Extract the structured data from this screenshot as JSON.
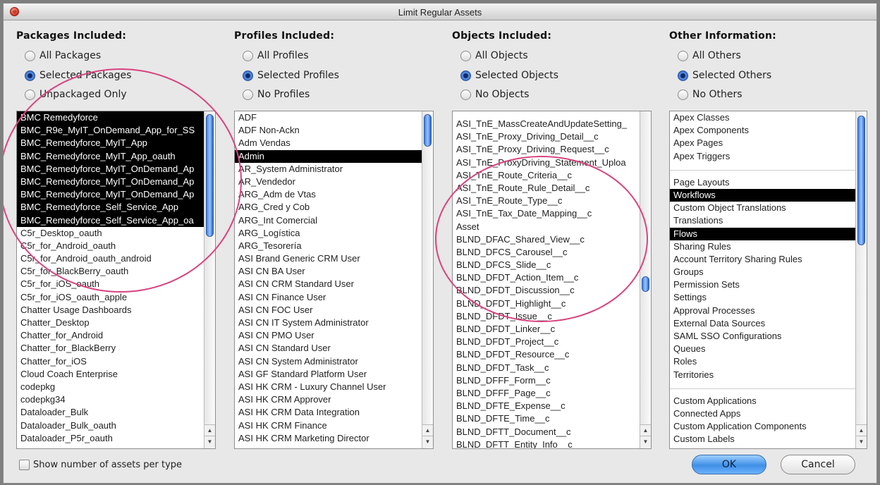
{
  "window": {
    "title": "Limit Regular Assets"
  },
  "columns": [
    {
      "header": "Packages Included:",
      "radios": [
        {
          "label": "All Packages",
          "checked": false
        },
        {
          "label": "Selected Packages",
          "checked": true
        },
        {
          "label": "Unpackaged Only",
          "checked": false
        }
      ],
      "items": [
        {
          "label": "BMC Remedyforce",
          "selected": true
        },
        {
          "label": "BMC_R9e_MyIT_OnDemand_App_for_SS",
          "selected": true
        },
        {
          "label": "BMC_Remedyforce_MyIT_App",
          "selected": true
        },
        {
          "label": "BMC_Remedyforce_MyIT_App_oauth",
          "selected": true
        },
        {
          "label": "BMC_Remedyforce_MyIT_OnDemand_Ap",
          "selected": true
        },
        {
          "label": "BMC_Remedyforce_MyIT_OnDemand_Ap",
          "selected": true
        },
        {
          "label": "BMC_Remedyforce_MyIT_OnDemand_Ap",
          "selected": true
        },
        {
          "label": "BMC_Remedyforce_Self_Service_App",
          "selected": true
        },
        {
          "label": "BMC_Remedyforce_Self_Service_App_oa",
          "selected": true
        },
        {
          "label": "C5r_Desktop_oauth",
          "selected": false
        },
        {
          "label": "C5r_for_Android_oauth",
          "selected": false
        },
        {
          "label": "C5r_for_Android_oauth_android",
          "selected": false
        },
        {
          "label": "C5r_for_BlackBerry_oauth",
          "selected": false
        },
        {
          "label": "C5r_for_iOS_oauth",
          "selected": false
        },
        {
          "label": "C5r_for_iOS_oauth_apple",
          "selected": false
        },
        {
          "label": "Chatter Usage Dashboards",
          "selected": false
        },
        {
          "label": "Chatter_Desktop",
          "selected": false
        },
        {
          "label": "Chatter_for_Android",
          "selected": false
        },
        {
          "label": "Chatter_for_BlackBerry",
          "selected": false
        },
        {
          "label": "Chatter_for_iOS",
          "selected": false
        },
        {
          "label": "Cloud Coach Enterprise",
          "selected": false
        },
        {
          "label": "codepkg",
          "selected": false
        },
        {
          "label": "codepkg34",
          "selected": false
        },
        {
          "label": "Dataloader_Bulk",
          "selected": false
        },
        {
          "label": "Dataloader_Bulk_oauth",
          "selected": false
        },
        {
          "label": "Dataloader_P5r_oauth",
          "selected": false
        }
      ]
    },
    {
      "header": "Profiles Included:",
      "radios": [
        {
          "label": "All Profiles",
          "checked": false
        },
        {
          "label": "Selected Profiles",
          "checked": true
        },
        {
          "label": "No Profiles",
          "checked": false
        }
      ],
      "items": [
        {
          "label": "ADF",
          "selected": false
        },
        {
          "label": "ADF Non-Ackn",
          "selected": false
        },
        {
          "label": "Adm Vendas",
          "selected": false
        },
        {
          "label": "Admin",
          "selected": true
        },
        {
          "label": "AR_System Administrator",
          "selected": false
        },
        {
          "label": "AR_Vendedor",
          "selected": false
        },
        {
          "label": "ARG_Adm de Vtas",
          "selected": false
        },
        {
          "label": "ARG_Cred y Cob",
          "selected": false
        },
        {
          "label": "ARG_Int Comercial",
          "selected": false
        },
        {
          "label": "ARG_Logística",
          "selected": false
        },
        {
          "label": "ARG_Tesorería",
          "selected": false
        },
        {
          "label": "ASI Brand Generic CRM User",
          "selected": false
        },
        {
          "label": "ASI CN BA User",
          "selected": false
        },
        {
          "label": "ASI CN CRM Standard User",
          "selected": false
        },
        {
          "label": "ASI CN Finance User",
          "selected": false
        },
        {
          "label": "ASI CN FOC User",
          "selected": false
        },
        {
          "label": "ASI CN IT System Administrator",
          "selected": false
        },
        {
          "label": "ASI CN PMO User",
          "selected": false
        },
        {
          "label": "ASI CN Standard User",
          "selected": false
        },
        {
          "label": "ASI CN System Administrator",
          "selected": false
        },
        {
          "label": "ASI GF Standard Platform User",
          "selected": false
        },
        {
          "label": "ASI HK CRM - Luxury Channel User",
          "selected": false
        },
        {
          "label": "ASI HK CRM Approver",
          "selected": false
        },
        {
          "label": "ASI HK CRM Data Integration",
          "selected": false
        },
        {
          "label": "ASI HK CRM Finance",
          "selected": false
        },
        {
          "label": "ASI HK CRM Marketing Director",
          "selected": false
        }
      ]
    },
    {
      "header": "Objects Included:",
      "radios": [
        {
          "label": "All Objects",
          "checked": false
        },
        {
          "label": "Selected Objects",
          "checked": true
        },
        {
          "label": "No Objects",
          "checked": false
        }
      ],
      "items": [
        {
          "label": "ASI_TnE_MassCreateAndUpdateSetting_",
          "selected": false
        },
        {
          "label": "ASI_TnE_Proxy_Driving_Detail__c",
          "selected": false
        },
        {
          "label": "ASI_TnE_Proxy_Driving_Request__c",
          "selected": false
        },
        {
          "label": "ASI_TnE_ProxyDriving_Statement_Uploa",
          "selected": false
        },
        {
          "label": "ASI_TnE_Route_Criteria__c",
          "selected": false
        },
        {
          "label": "ASI_TnE_Route_Rule_Detail__c",
          "selected": false
        },
        {
          "label": "ASI_TnE_Route_Type__c",
          "selected": false
        },
        {
          "label": "ASI_TnE_Tax_Date_Mapping__c",
          "selected": false
        },
        {
          "label": "Asset",
          "selected": false
        },
        {
          "label": "BLND_DFAC_Shared_View__c",
          "selected": false
        },
        {
          "label": "BLND_DFCS_Carousel__c",
          "selected": false
        },
        {
          "label": "BLND_DFCS_Slide__c",
          "selected": false
        },
        {
          "label": "BLND_DFDT_Action_Item__c",
          "selected": false
        },
        {
          "label": "BLND_DFDT_Discussion__c",
          "selected": false
        },
        {
          "label": "BLND_DFDT_Highlight__c",
          "selected": false
        },
        {
          "label": "BLND_DFDT_Issue__c",
          "selected": false
        },
        {
          "label": "BLND_DFDT_Linker__c",
          "selected": false
        },
        {
          "label": "BLND_DFDT_Project__c",
          "selected": false
        },
        {
          "label": "BLND_DFDT_Resource__c",
          "selected": false
        },
        {
          "label": "BLND_DFDT_Task__c",
          "selected": false
        },
        {
          "label": "BLND_DFFF_Form__c",
          "selected": false
        },
        {
          "label": "BLND_DFFF_Page__c",
          "selected": false
        },
        {
          "label": "BLND_DFTE_Expense__c",
          "selected": false
        },
        {
          "label": "BLND_DFTE_Time__c",
          "selected": false
        },
        {
          "label": "BLND_DFTT_Document__c",
          "selected": false
        },
        {
          "label": "BLND_DFTT_Entity_Info__c",
          "selected": false
        }
      ]
    },
    {
      "header": "Other Information:",
      "radios": [
        {
          "label": "All Others",
          "checked": false
        },
        {
          "label": "Selected Others",
          "checked": true
        },
        {
          "label": "No Others",
          "checked": false
        }
      ],
      "items": [
        {
          "label": "Apex Classes",
          "selected": false
        },
        {
          "label": "Apex Components",
          "selected": false
        },
        {
          "label": "Apex Pages",
          "selected": false
        },
        {
          "label": "Apex Triggers",
          "selected": false
        },
        {
          "label": "",
          "selected": false,
          "gap": true
        },
        {
          "label": "Page Layouts",
          "selected": false
        },
        {
          "label": "Workflows",
          "selected": true
        },
        {
          "label": "Custom Object Translations",
          "selected": false
        },
        {
          "label": "Translations",
          "selected": false
        },
        {
          "label": "Flows",
          "selected": true
        },
        {
          "label": "Sharing Rules",
          "selected": false
        },
        {
          "label": "Account Territory Sharing Rules",
          "selected": false
        },
        {
          "label": "Groups",
          "selected": false
        },
        {
          "label": "Permission Sets",
          "selected": false
        },
        {
          "label": "Settings",
          "selected": false
        },
        {
          "label": "Approval Processes",
          "selected": false
        },
        {
          "label": "External Data Sources",
          "selected": false
        },
        {
          "label": "SAML SSO Configurations",
          "selected": false
        },
        {
          "label": "Queues",
          "selected": false
        },
        {
          "label": "Roles",
          "selected": false
        },
        {
          "label": "Territories",
          "selected": false
        },
        {
          "label": "",
          "selected": false,
          "gap": true
        },
        {
          "label": "Custom Applications",
          "selected": false
        },
        {
          "label": "Connected Apps",
          "selected": false
        },
        {
          "label": "Custom Application Components",
          "selected": false
        },
        {
          "label": "Custom Labels",
          "selected": false
        }
      ]
    }
  ],
  "footer": {
    "show_count_label": "Show number of assets per type",
    "show_count_checked": false,
    "ok_label": "OK",
    "cancel_label": "Cancel"
  },
  "colors": {
    "selection": "#000000",
    "annotation_circle": "#d8437f",
    "ok_button": "#3f8fe6"
  }
}
